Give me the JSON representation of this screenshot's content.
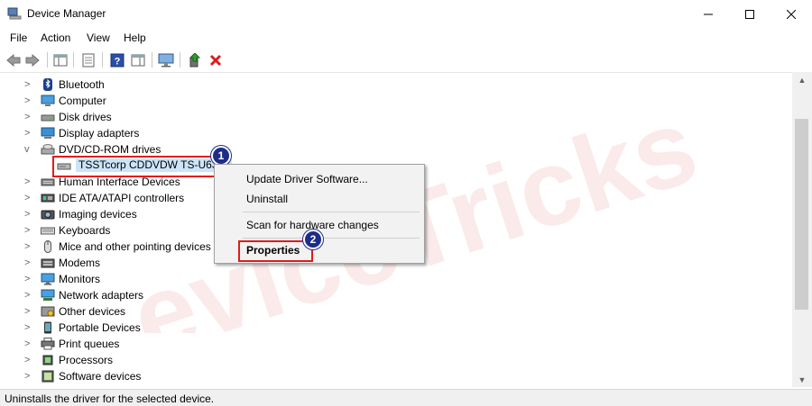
{
  "window": {
    "title": "Device Manager",
    "controls": {
      "minimize_icon": "minimize-icon",
      "maximize_icon": "maximize-icon",
      "close_icon": "close-icon"
    }
  },
  "menubar": [
    "File",
    "Action",
    "View",
    "Help"
  ],
  "toolbar": [
    "back",
    "forward",
    "show-hide-console-tree",
    "properties",
    "help",
    "action-pane",
    "scan-for-hardware-changes",
    "update-driver",
    "uninstall"
  ],
  "tree": {
    "rows": [
      {
        "label": "Bluetooth",
        "icon": "bluetooth-icon",
        "expander": ">"
      },
      {
        "label": "Computer",
        "icon": "computer-icon",
        "expander": ">"
      },
      {
        "label": "Disk drives",
        "icon": "disk-drive-icon",
        "expander": ">"
      },
      {
        "label": "Display adapters",
        "icon": "display-adapter-icon",
        "expander": ">"
      },
      {
        "label": "DVD/CD-ROM drives",
        "icon": "dvd-drive-icon",
        "expander": "v"
      },
      {
        "label": "TSSTcorp CDDVDW TS-U633J",
        "icon": "optical-drive-icon",
        "expander": ""
      },
      {
        "label": "Human Interface Devices",
        "icon": "hid-icon",
        "expander": ">"
      },
      {
        "label": "IDE ATA/ATAPI controllers",
        "icon": "ide-controller-icon",
        "expander": ">"
      },
      {
        "label": "Imaging devices",
        "icon": "camera-icon",
        "expander": ">"
      },
      {
        "label": "Keyboards",
        "icon": "keyboard-icon",
        "expander": ">"
      },
      {
        "label": "Mice and other pointing devices",
        "icon": "mouse-icon",
        "expander": ">"
      },
      {
        "label": "Modems",
        "icon": "modem-icon",
        "expander": ">"
      },
      {
        "label": "Monitors",
        "icon": "monitor-icon",
        "expander": ">"
      },
      {
        "label": "Network adapters",
        "icon": "network-adapter-icon",
        "expander": ">"
      },
      {
        "label": "Other devices",
        "icon": "other-devices-icon",
        "expander": ">"
      },
      {
        "label": "Portable Devices",
        "icon": "portable-device-icon",
        "expander": ">"
      },
      {
        "label": "Print queues",
        "icon": "printer-icon",
        "expander": ">"
      },
      {
        "label": "Processors",
        "icon": "processor-icon",
        "expander": ">"
      },
      {
        "label": "Software devices",
        "icon": "software-device-icon",
        "expander": ">"
      }
    ]
  },
  "context_menu": {
    "items": [
      "Update Driver Software...",
      "Uninstall",
      "Scan for hardware changes",
      "Properties"
    ]
  },
  "callouts": [
    "1",
    "2"
  ],
  "watermark": "eviceTricks",
  "status": "Uninstalls the driver for the selected device.",
  "colors": {
    "highlight_box": "#e21a1a",
    "callout_bg": "#1e2d88",
    "watermark": "#f2c4c4"
  }
}
